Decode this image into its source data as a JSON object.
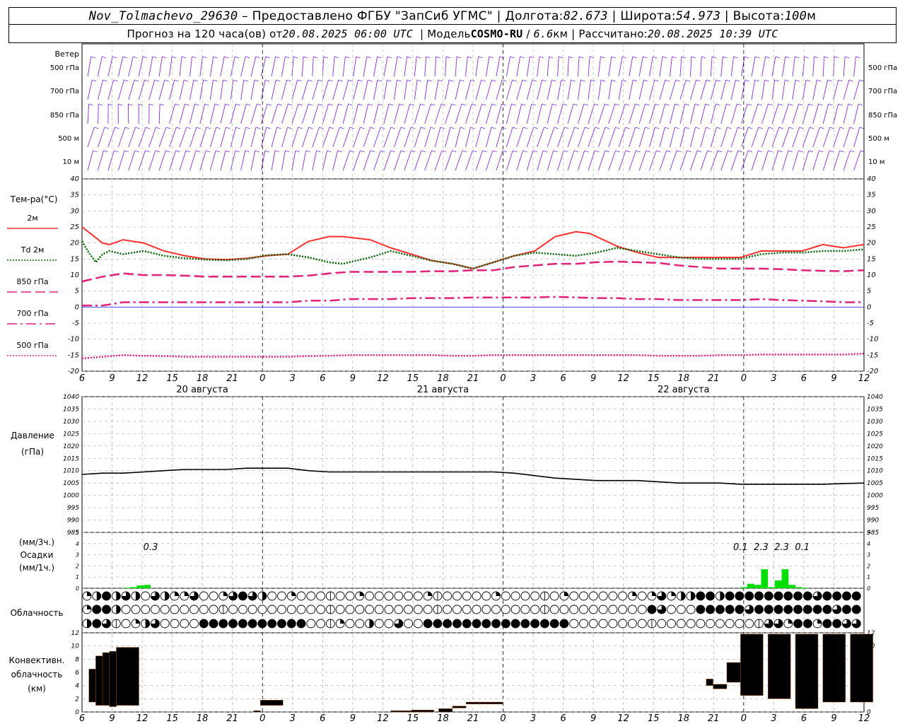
{
  "header": {
    "station": "Nov_Tolmachevo_29630",
    "provider": "Предоставлено ФГБУ \"ЗапСиб УГМС\"",
    "lon_label": "Долгота:",
    "lon_value": "82.673",
    "lat_label": "Широта:",
    "lat_value": "54.973",
    "alt_label": "Высота:",
    "alt_value": "100",
    "alt_unit": "м",
    "forecast_prefix": "Прогноз на 120 часа(ов) от",
    "forecast_time": "20.08.2025 06:00 UTC",
    "model_label": "Модель",
    "model_name": "COSMO-RU",
    "model_res": "6.6",
    "model_res_unit": "км",
    "computed_label": "Рассчитано:",
    "computed_time": "20.08.2025 10:39 UTC"
  },
  "wind_panel": {
    "title": "Ветер",
    "levels": [
      "500 гПа",
      "700 гПа",
      "850 гПа",
      "500 м",
      "10  м"
    ],
    "color": "#8a2be2"
  },
  "x_hours": [
    "6",
    "9",
    "12",
    "15",
    "18",
    "21",
    "0",
    "3",
    "6",
    "9",
    "12",
    "15",
    "18",
    "21",
    "0",
    "3",
    "6",
    "9",
    "12",
    "15",
    "18",
    "21",
    "0",
    "3",
    "6",
    "9",
    "12"
  ],
  "dates": [
    "20 августа",
    "21 августа",
    "22 августа"
  ],
  "temp_panel": {
    "title": "Тем-ра(°C)",
    "yticks": [
      "40",
      "35",
      "30",
      "25",
      "20",
      "15",
      "10",
      "5",
      "0",
      "-5",
      "-10",
      "-15",
      "-20"
    ],
    "legend": [
      {
        "label": "2м",
        "color": "#ff3030",
        "style": "solid"
      },
      {
        "label": "Td  2м",
        "color": "#006400",
        "style": "dotted"
      },
      {
        "label": "850 гПа",
        "color": "#e0207a",
        "style": "longdash"
      },
      {
        "label": "700 гПа",
        "color": "#e0207a",
        "style": "dashdot"
      },
      {
        "label": "500 гПа",
        "color": "#e0207a",
        "style": "dense"
      }
    ]
  },
  "pressure_panel": {
    "title": "Давление",
    "unit": "(гПа)",
    "yticks": [
      "1040",
      "1035",
      "1030",
      "1025",
      "1020",
      "1015",
      "1010",
      "1005",
      "1000",
      "995",
      "990",
      "985"
    ]
  },
  "precip_panel": {
    "unit3h": "(мм/3ч.)",
    "title": "Осадки",
    "unit1h": "(мм/1ч.)",
    "yticks": [
      "5",
      "4",
      "3",
      "2",
      "1",
      "0"
    ],
    "labels": [
      {
        "hour": 10,
        "text": "0.3"
      },
      {
        "hour": 96,
        "text": "0.1"
      },
      {
        "hour": 99,
        "text": "2.3"
      },
      {
        "hour": 102,
        "text": "2.3"
      },
      {
        "hour": 105,
        "text": "0.1"
      }
    ],
    "color": "#00dd00"
  },
  "cloud_panel": {
    "title": "Облачность"
  },
  "conv_panel": {
    "title1": "Конвективн.",
    "title2": "облачность",
    "unit": "(км)",
    "yticks": [
      "12",
      "10",
      "8",
      "6",
      "4",
      "2",
      "0"
    ],
    "color": "#f0882a"
  },
  "chart_data": [
    {
      "type": "line",
      "title": "Тем-ра(°C)",
      "x_unit": "hours from 20.08.2025 06:00 UTC",
      "ylim": [
        -20,
        40
      ],
      "series": [
        {
          "name": "2м",
          "x": [
            0,
            3,
            4,
            6,
            9,
            12,
            15,
            18,
            21,
            24,
            27,
            30,
            33,
            36,
            38,
            42,
            45,
            48,
            51,
            54,
            57,
            60,
            63,
            66,
            69,
            72,
            74,
            78,
            81,
            84,
            87,
            90,
            93,
            96,
            99,
            102,
            105,
            108,
            111,
            114
          ],
          "values": [
            25,
            20,
            19.5,
            21,
            20,
            17.5,
            16,
            15,
            14.8,
            15.2,
            16,
            16.5,
            20.5,
            22,
            22,
            21,
            18.5,
            16.5,
            14.5,
            13.5,
            12,
            14,
            16,
            17.5,
            22,
            23.5,
            23,
            19,
            17,
            15.5,
            15.5,
            15.5,
            15.5,
            15.5,
            17.5,
            17.5,
            17.5,
            19.5,
            18.5,
            19.5
          ]
        },
        {
          "name": "Td  2м",
          "x": [
            0,
            1,
            2,
            3,
            4,
            5,
            6,
            9,
            12,
            15,
            18,
            21,
            24,
            27,
            30,
            33,
            36,
            38,
            42,
            45,
            48,
            51,
            54,
            57,
            60,
            63,
            66,
            69,
            72,
            75,
            78,
            81,
            84,
            87,
            90,
            93,
            96,
            99,
            102,
            105,
            108,
            111,
            114
          ],
          "values": [
            20.5,
            17,
            14,
            16.5,
            17.5,
            17,
            16.5,
            17.5,
            16,
            15.2,
            14.8,
            14.6,
            15,
            16.2,
            16.5,
            15.5,
            14,
            13.5,
            15.5,
            17.5,
            16,
            14.5,
            13.5,
            12,
            14,
            16,
            17,
            16.5,
            16,
            17,
            18.5,
            17.5,
            16.5,
            15.5,
            15,
            15,
            15,
            16.5,
            17,
            17,
            17.5,
            17.5,
            18
          ]
        },
        {
          "name": "850 гПа",
          "x": [
            0,
            3,
            6,
            9,
            12,
            15,
            18,
            21,
            24,
            27,
            30,
            33,
            36,
            39,
            42,
            45,
            48,
            51,
            54,
            57,
            60,
            63,
            66,
            69,
            72,
            75,
            78,
            81,
            84,
            87,
            90,
            93,
            96,
            99,
            102,
            105,
            108,
            111,
            114
          ],
          "values": [
            8,
            9.5,
            10.5,
            10,
            10,
            9.8,
            9.5,
            9.5,
            9.5,
            9.5,
            9.5,
            9.8,
            10.5,
            11,
            11,
            11,
            11,
            11.2,
            11.2,
            11.5,
            11.5,
            12.5,
            13,
            13.5,
            13.5,
            14,
            14.2,
            14,
            13.8,
            13,
            12.5,
            12,
            12,
            12,
            11.8,
            11.5,
            11.3,
            11.2,
            11.5
          ]
        },
        {
          "name": "700 гПа",
          "x": [
            0,
            3,
            6,
            9,
            12,
            15,
            18,
            21,
            24,
            27,
            30,
            33,
            36,
            39,
            42,
            45,
            48,
            51,
            54,
            57,
            60,
            63,
            66,
            69,
            72,
            75,
            78,
            81,
            84,
            87,
            90,
            93,
            96,
            99,
            102,
            105,
            108,
            111,
            114
          ],
          "values": [
            0.5,
            0.5,
            1.5,
            1.5,
            1.5,
            1.5,
            1.5,
            1.5,
            1.5,
            1.5,
            1.5,
            2,
            2,
            2.5,
            2.5,
            2.5,
            2.8,
            2.8,
            2.8,
            3,
            3,
            3,
            3,
            3.2,
            3,
            2.8,
            2.8,
            2.5,
            2.5,
            2.2,
            2.2,
            2.2,
            2.2,
            2.5,
            2.2,
            2,
            1.8,
            1.5,
            1.5
          ]
        },
        {
          "name": "500 гПа",
          "x": [
            0,
            3,
            6,
            9,
            12,
            15,
            18,
            21,
            24,
            27,
            30,
            33,
            36,
            39,
            42,
            45,
            48,
            51,
            54,
            57,
            60,
            63,
            66,
            69,
            72,
            75,
            78,
            81,
            84,
            87,
            90,
            93,
            96,
            99,
            102,
            105,
            108,
            111,
            114
          ],
          "values": [
            -16,
            -15.5,
            -15,
            -15.2,
            -15.3,
            -15.5,
            -15.5,
            -15.5,
            -15.5,
            -15.5,
            -15.5,
            -15.3,
            -15.2,
            -15,
            -15,
            -15,
            -15,
            -15,
            -15.2,
            -15.2,
            -15,
            -15,
            -15,
            -15,
            -15,
            -15,
            -15,
            -15,
            -15.2,
            -15.2,
            -15.2,
            -15,
            -15,
            -14.8,
            -14.8,
            -14.8,
            -14.8,
            -14.8,
            -14.5
          ]
        }
      ]
    },
    {
      "type": "line",
      "title": "Давление",
      "ylabel": "(гПа)",
      "ylim": [
        985,
        1040
      ],
      "series": [
        {
          "x": [
            0,
            3,
            6,
            9,
            12,
            15,
            18,
            21,
            24,
            27,
            30,
            33,
            36,
            39,
            42,
            45,
            48,
            51,
            54,
            57,
            60,
            63,
            66,
            69,
            72,
            75,
            78,
            81,
            84,
            87,
            90,
            93,
            96,
            99,
            102,
            105,
            108,
            111,
            114
          ],
          "values": [
            1008.5,
            1009,
            1009,
            1009.5,
            1010,
            1010.5,
            1010.5,
            1010.5,
            1011,
            1011,
            1011,
            1010,
            1009.5,
            1009.5,
            1009.5,
            1009.5,
            1009.5,
            1009.5,
            1009.5,
            1009.5,
            1009.5,
            1009,
            1008,
            1007,
            1006.5,
            1006,
            1006,
            1006,
            1005.5,
            1005,
            1005,
            1005,
            1004.5,
            1004.5,
            1004.5,
            1004.5,
            1004.5,
            1004.8,
            1005
          ]
        }
      ]
    },
    {
      "type": "bar",
      "title": "Осадки",
      "ylabel": "(мм/1ч.)",
      "ylim": [
        0,
        5
      ],
      "x": [
        7,
        8,
        9,
        10,
        97,
        98,
        99,
        100,
        101,
        102,
        103,
        104,
        105,
        106
      ],
      "values": [
        0.05,
        0.1,
        0.25,
        0.3,
        0.1,
        0.4,
        0.3,
        1.7,
        0.1,
        0.7,
        1.7,
        0.3,
        0.1,
        0.05
      ]
    },
    {
      "type": "bar",
      "title": "Конвективн. облачность",
      "ylabel": "(км)",
      "ylim": [
        0,
        12
      ],
      "bars": [
        {
          "x": 1,
          "bottom": 1.5,
          "top": 6.5
        },
        {
          "x": 2,
          "bottom": 1,
          "top": 8.5
        },
        {
          "x": 3,
          "bottom": 1,
          "top": 9
        },
        {
          "x": 4,
          "bottom": 0.8,
          "top": 9.2
        },
        {
          "x": 5,
          "bottom": 1,
          "top": 9.8
        },
        {
          "x": 25,
          "bottom": 0,
          "top": 0.2
        },
        {
          "x": 26,
          "bottom": 1,
          "top": 1.8
        },
        {
          "x": 45,
          "bottom": 0,
          "top": 0.2
        },
        {
          "x": 48,
          "bottom": 0,
          "top": 0.3
        },
        {
          "x": 52,
          "bottom": 0,
          "top": 0.5
        },
        {
          "x": 54,
          "bottom": 0.6,
          "top": 0.9
        },
        {
          "x": 56,
          "bottom": 1.2,
          "top": 1.5
        },
        {
          "x": 58,
          "bottom": 1.2,
          "top": 1.5
        },
        {
          "x": 91,
          "bottom": 4,
          "top": 5
        },
        {
          "x": 92,
          "bottom": 3.5,
          "top": 4.2
        },
        {
          "x": 94,
          "bottom": 4.5,
          "top": 7.5
        },
        {
          "x": 96,
          "bottom": 2.5,
          "top": 11.8
        },
        {
          "x": 100,
          "bottom": 2,
          "top": 11.8
        },
        {
          "x": 104,
          "bottom": 0.5,
          "top": 11.8
        },
        {
          "x": 108,
          "bottom": 1.5,
          "top": 11.8
        },
        {
          "x": 112,
          "bottom": 1.5,
          "top": 11.8
        }
      ]
    }
  ]
}
